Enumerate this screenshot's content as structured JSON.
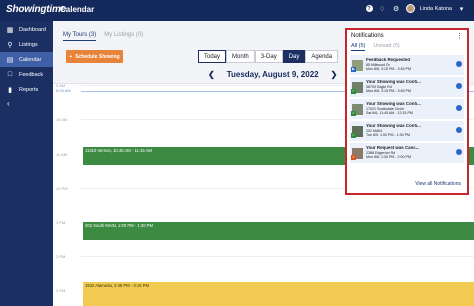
{
  "app": {
    "logo": "Showingtime",
    "page_title": "Calendar"
  },
  "topbar": {
    "help_icon": "?",
    "user_name": "Linda Katona",
    "bell_icon": "bell-icon",
    "gear_icon": "gear-icon"
  },
  "sidebar": {
    "items": [
      {
        "label": "Dashboard",
        "icon": "grid-icon"
      },
      {
        "label": "Listings",
        "icon": "search-icon"
      },
      {
        "label": "Calendar",
        "icon": "calendar-icon"
      },
      {
        "label": "Feedback",
        "icon": "comment-icon"
      },
      {
        "label": "Reports",
        "icon": "chart-icon"
      }
    ]
  },
  "main": {
    "tabs": [
      {
        "label": "My Tours (3)"
      },
      {
        "label": "My Listings (0)"
      }
    ],
    "schedule_button": "Schedule Showing",
    "views": [
      "Today",
      "Month",
      "3-Day",
      "Day",
      "Agenda"
    ],
    "selected_view": "Day",
    "date_title": "Tuesday, August 9, 2022",
    "hours": [
      "9 AM",
      "10 AM",
      "11 AM",
      "12 PM",
      "1 PM",
      "2 PM",
      "3 PM"
    ],
    "now_label": "9:03 AM",
    "events": [
      {
        "label": "11310 Vernon, 10:45 AM - 11:15 AM",
        "color": "green"
      },
      {
        "label": "202 South MAIN, 1:00 PM - 1:30 PM",
        "color": "green"
      },
      {
        "label": "1532 Alameda, 2:45 PM - 3:15 PM",
        "color": "yellow"
      }
    ]
  },
  "notifications": {
    "title": "Notifications",
    "tabs": [
      {
        "label": "All (5)"
      },
      {
        "label": "Unread (5)"
      }
    ],
    "items": [
      {
        "title": "Feedback Requested",
        "line1": "85 Millwood Dr",
        "line2": "Mon 8/8, 3:15 PM - 3:45 PM",
        "badge": "blue"
      },
      {
        "title": "Your Showing was Confi...",
        "line1": "36700 Eagle Rd",
        "line2": "Mon 8/8, 3:15 PM - 3:45 PM",
        "badge": "green"
      },
      {
        "title": "Your Showing was Confi...",
        "line1": "17021 Scottsdale Circle",
        "line2": "Sat 8/6, 11:45 AM - 12:15 PM",
        "badge": "green"
      },
      {
        "title": "Your Showing was Confi...",
        "line1": "202 MAIN",
        "line2": "Tue 8/9, 1:00 PM - 1:30 PM",
        "badge": "green"
      },
      {
        "title": "Your Request was Canc...",
        "line1": "2388 Edgerton Rd",
        "line2": "Mon 8/8, 1:30 PM - 2:00 PM",
        "badge": "orange"
      }
    ],
    "view_all": "View all Notifications"
  }
}
